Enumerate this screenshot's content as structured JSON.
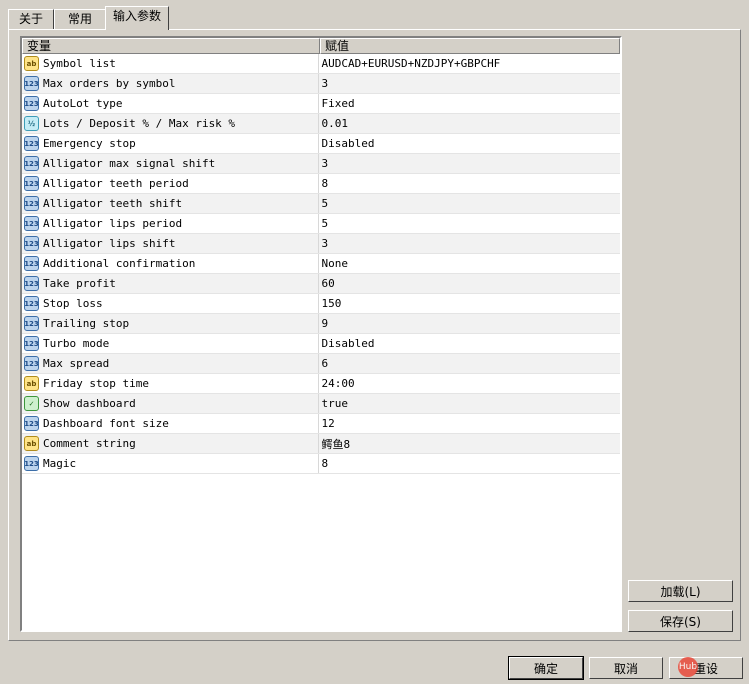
{
  "tabs": [
    {
      "label": "关于"
    },
    {
      "label": "常用"
    },
    {
      "label": "输入参数"
    }
  ],
  "grid": {
    "columns": [
      "变量",
      "赋值"
    ],
    "rows": [
      {
        "type": "str",
        "icon_text": "ab",
        "name": "Symbol list",
        "value": "AUDCAD+EURUSD+NZDJPY+GBPCHF"
      },
      {
        "type": "num",
        "icon_text": "123",
        "name": "Max orders by symbol",
        "value": "3"
      },
      {
        "type": "num",
        "icon_text": "123",
        "name": "AutoLot type",
        "value": "Fixed"
      },
      {
        "type": "dbl",
        "icon_text": "½",
        "name": "Lots / Deposit % / Max risk %",
        "value": "0.01"
      },
      {
        "type": "num",
        "icon_text": "123",
        "name": "Emergency stop",
        "value": "Disabled"
      },
      {
        "type": "num",
        "icon_text": "123",
        "name": "Alligator max signal shift",
        "value": "3"
      },
      {
        "type": "num",
        "icon_text": "123",
        "name": "Alligator teeth period",
        "value": "8"
      },
      {
        "type": "num",
        "icon_text": "123",
        "name": "Alligator teeth shift",
        "value": "5"
      },
      {
        "type": "num",
        "icon_text": "123",
        "name": "Alligator lips period",
        "value": "5"
      },
      {
        "type": "num",
        "icon_text": "123",
        "name": "Alligator lips shift",
        "value": "3"
      },
      {
        "type": "num",
        "icon_text": "123",
        "name": "Additional confirmation",
        "value": "None"
      },
      {
        "type": "num",
        "icon_text": "123",
        "name": "Take profit",
        "value": "60"
      },
      {
        "type": "num",
        "icon_text": "123",
        "name": "Stop loss",
        "value": "150"
      },
      {
        "type": "num",
        "icon_text": "123",
        "name": "Trailing stop",
        "value": "9"
      },
      {
        "type": "num",
        "icon_text": "123",
        "name": "Turbo mode",
        "value": "Disabled"
      },
      {
        "type": "num",
        "icon_text": "123",
        "name": "Max spread",
        "value": "6"
      },
      {
        "type": "str",
        "icon_text": "ab",
        "name": "Friday stop time",
        "value": "24:00"
      },
      {
        "type": "bool",
        "icon_text": "✓",
        "name": "Show dashboard",
        "value": "true"
      },
      {
        "type": "num",
        "icon_text": "123",
        "name": "Dashboard font size",
        "value": "12"
      },
      {
        "type": "str",
        "icon_text": "ab",
        "name": "Comment string",
        "value": "鳄鱼8"
      },
      {
        "type": "num",
        "icon_text": "123",
        "name": "Magic",
        "value": "8"
      }
    ]
  },
  "side_buttons": {
    "load": "加载(L)",
    "save": "保存(S)"
  },
  "footer_buttons": {
    "ok": "确定",
    "cancel": "取消",
    "reset": "重设"
  },
  "watermark": {
    "text": "Hub"
  }
}
